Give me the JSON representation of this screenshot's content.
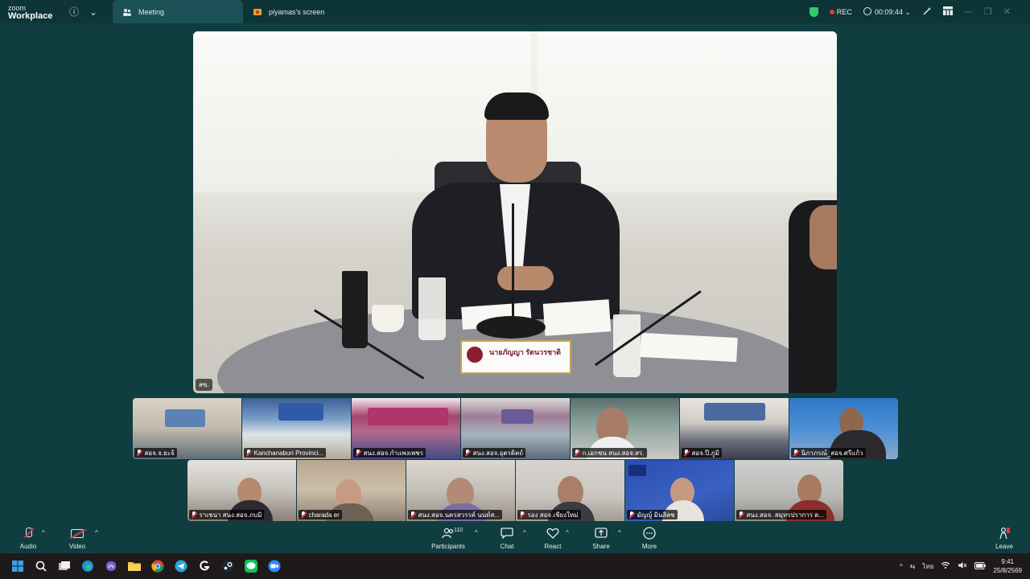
{
  "app": {
    "logo_line1": "zoom",
    "logo_line2": "Workplace"
  },
  "tabs": [
    {
      "label": "Meeting",
      "icon": "meeting-icon",
      "active": true
    },
    {
      "label": "piyamas's screen",
      "icon": "screen-share-icon",
      "active": false
    }
  ],
  "titlebar": {
    "rec_label": "REC",
    "timer": "00:09:44",
    "rec_color": "#e8344a",
    "secure_color": "#2ecc71"
  },
  "speaker": {
    "label": "สซ.",
    "nameplate": "นายภัญญา รัตนวรชาติ"
  },
  "row1": [
    "สอจ.จ.ยะจ้",
    "Kanchanaburi Provinci...",
    "สนง.สอจ.กำแพงเพชร",
    "สนง.สอจ.อุตรดิตถ์",
    "ก.เอกชน สนง.สอจ.สร.",
    "สอจ.ปี.ภูมิ",
    "นิภาภรณ์_สอจ.ศรีแก้ว"
  ],
  "row2": [
    "ราเชนา สนง.สอจ.ภบมิ",
    "charada er",
    "สนง.สอจ.นครสวรรค์ นนท์ส...",
    "รอง สอจ.เชียงใหม่",
    "มัญญ์ มินลิลช",
    "สนง.สอจ. สมุทรปราการ ด..."
  ],
  "controls": {
    "audio": "Audio",
    "video": "Video",
    "participants": "Participants",
    "participant_count": "110",
    "chat": "Chat",
    "react": "React",
    "share": "Share",
    "more": "More",
    "leave": "Leave"
  },
  "taskbar": {
    "apps": [
      "windows-start-icon",
      "search-icon",
      "task-view-icon",
      "edge-icon",
      "copilot-icon",
      "file-explorer-icon",
      "chrome-icon",
      "telegram-icon",
      "app-g-icon",
      "steam-icon",
      "line-icon",
      "zoom-taskbar-icon"
    ],
    "language": "ไทย",
    "time": "9:41",
    "date": "25/8/2569"
  }
}
